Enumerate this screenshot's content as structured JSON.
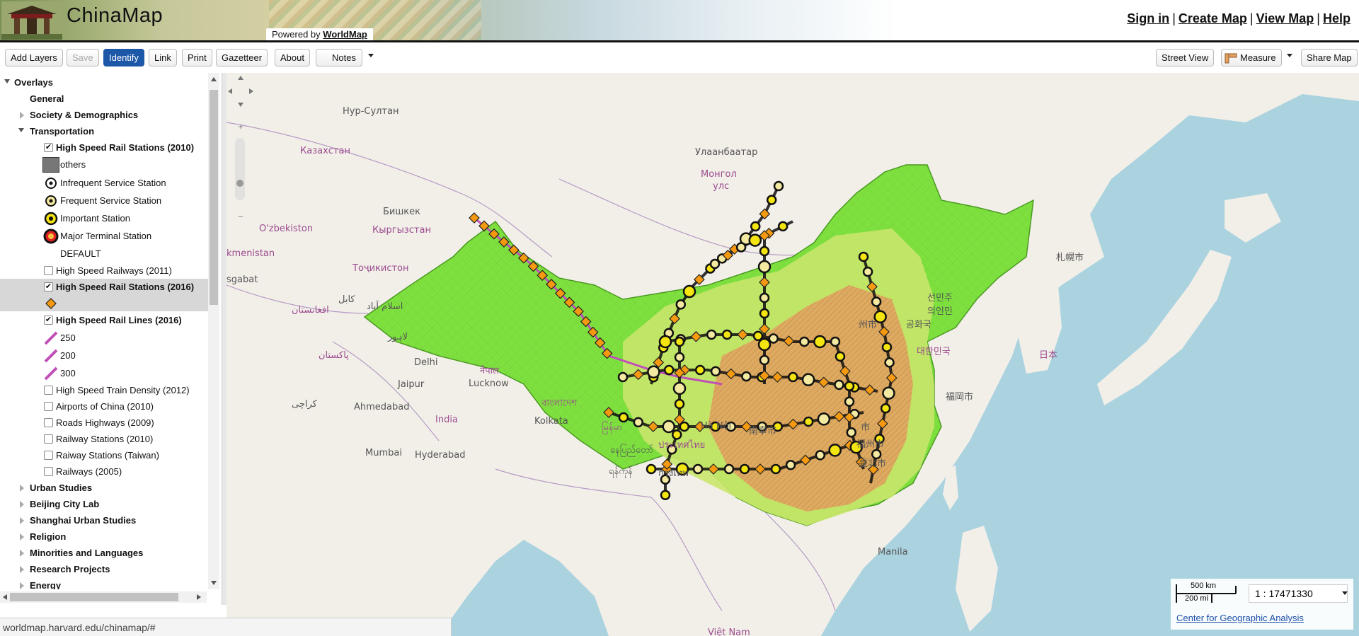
{
  "header": {
    "app_title": "ChinaMap",
    "powered_prefix": "Powered by",
    "powered_brand": "WorldMap",
    "nav": [
      "Sign in",
      "Create Map",
      "View Map",
      "Help"
    ],
    "nav_separator": "|"
  },
  "toolbar": {
    "add_layers": "Add Layers",
    "save": "Save",
    "identify": "Identify",
    "link": "Link",
    "print": "Print",
    "gazetteer": "Gazetteer",
    "about": "About",
    "notes": "Notes",
    "street_view": "Street View",
    "measure": "Measure",
    "share_map": "Share Map"
  },
  "tree": {
    "overlays": "Overlays",
    "general": "General",
    "society": "Society & Demographics",
    "transportation": "Transportation",
    "hsr_stations_2010": "High Speed Rail Stations (2010)",
    "legend_others": "others",
    "legend_infrequent": "Infrequent Service Station",
    "legend_frequent": "Frequent Service Station",
    "legend_important": "Important Station",
    "legend_major": "Major Terminal Station",
    "legend_default": "DEFAULT",
    "hsr_railways_2011": "High Speed Railways (2011)",
    "hsr_stations_2016": "High Speed Rail Stations (2016)",
    "hsr_lines_2016": "High Speed Rail Lines (2016)",
    "line_250": "250",
    "line_200": "200",
    "line_300": "300",
    "train_density_2012": "High Speed Train Density (2012)",
    "airports_2010": "Airports of China (2010)",
    "roads_2009": "Roads Highways (2009)",
    "railway_stations_2010": "Railway Stations (2010)",
    "railway_stations_taiwan": "Raiway Stations (Taiwan)",
    "railways_2005": "Railways (2005)",
    "urban_studies": "Urban Studies",
    "beijing_city_lab": "Beijing City Lab",
    "shanghai_urban": "Shanghai Urban Studies",
    "religion": "Religion",
    "minorities": "Minorities and Languages",
    "research_projects": "Research Projects",
    "energy": "Energy",
    "checked": "✔"
  },
  "map": {
    "labels": {
      "nur_sultan": "Нур-Султан",
      "kazakhstan": "Казахстан",
      "ulaanbaatar": "Улаанбаатар",
      "mongolia_1": "Монгол",
      "mongolia_2": "улс",
      "bishkek": "Бишкек",
      "uzbekistan": "O'zbekiston",
      "kyrgyzstan": "Кыргызстан",
      "turkmenistan": "kmenistan",
      "tajikistan": "Тоҷикистон",
      "ashgabat": "sgabat",
      "kabul": "کابل",
      "islamabad": "اسلام آباد",
      "afghanistan": "افغانستان",
      "lahore": "لاہور",
      "pakistan": "پاکستان",
      "delhi": "Delhi",
      "nepal": "नेपाल",
      "jaipur": "Jaipur",
      "lucknow": "Lucknow",
      "karachi": "کراچی",
      "ahmedabad": "Ahmedabad",
      "india": "India",
      "bangladesh": "বাংলাদেশ",
      "kolkata": "Kolkata",
      "myanmar": "မြန်မာ",
      "mumbai": "Mumbai",
      "hyderabad": "Hyderabad",
      "naypyidaw": "နေပြည်တော်",
      "thailand": "ประเทศไทย",
      "yangon": "ရန်ကုန်",
      "bangkok": "กรุงเทพ",
      "ha_noi": "Hà Nội",
      "sapporo": "札幌市",
      "japan": "日本",
      "korea_north": "선민주",
      "korea_north2": "의인민",
      "korea_south": "공화국",
      "south_korea": "대한민국",
      "fukuoka": "福岡市",
      "taipei": "臺北市",
      "manila": "Manila",
      "vietnam": "Việt Nam",
      "seoul_area": "州市",
      "fuzhou": "福州市",
      "nanning": "南寧市",
      "shanghai_area": "市"
    },
    "scale_km": "500 km",
    "scale_mi": "200 mi",
    "scale_ratio": "1 : 17471330",
    "attribution": "Center for Geographic Analysis",
    "colors": {
      "water": "#aad3df",
      "land": "#f2efe9",
      "china_green": "#7ee03f",
      "dense_orange": "#e8945a",
      "station_fill": "#f59a10",
      "rail_line": "#c04fb8"
    }
  },
  "status": {
    "url": "worldmap.harvard.edu/chinamap/#"
  }
}
